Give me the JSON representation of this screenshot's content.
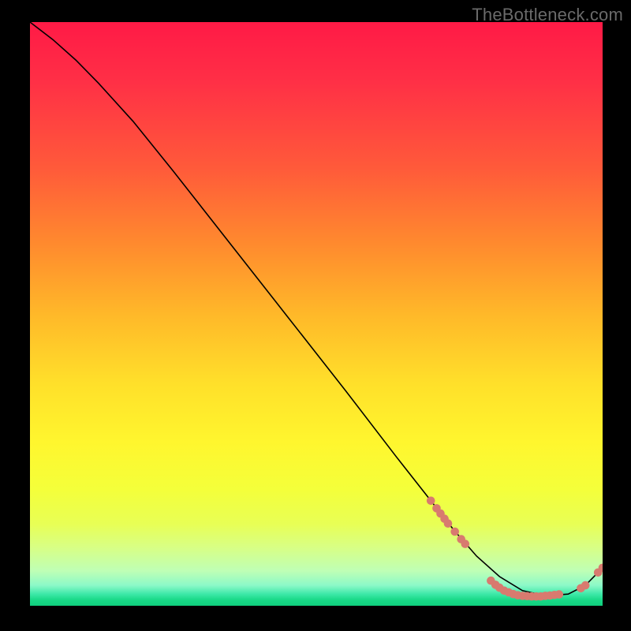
{
  "watermark": "TheBottleneck.com",
  "colors": {
    "line": "#000000",
    "marker": "#d87a6f",
    "background": "#000000"
  },
  "chart_data": {
    "type": "line",
    "title": "",
    "xlabel": "",
    "ylabel": "",
    "xlim": [
      0,
      100
    ],
    "ylim": [
      0,
      100
    ],
    "grid": false,
    "legend": false,
    "series": [
      {
        "name": "curve",
        "x": [
          0,
          4,
          8,
          12,
          18,
          25,
          35,
          45,
          55,
          64,
          70,
          74,
          78,
          82,
          86,
          90,
          94,
          97,
          100
        ],
        "y": [
          100,
          97,
          93.5,
          89.5,
          83,
          74.5,
          62,
          49.5,
          37,
          25.5,
          18,
          13,
          8.5,
          5,
          2.6,
          1.7,
          2.0,
          3.5,
          6.5
        ]
      }
    ],
    "markers": [
      {
        "x": 70.0,
        "y": 18.0
      },
      {
        "x": 71.0,
        "y": 16.7
      },
      {
        "x": 71.7,
        "y": 15.8
      },
      {
        "x": 72.4,
        "y": 14.9
      },
      {
        "x": 73.0,
        "y": 14.1
      },
      {
        "x": 74.2,
        "y": 12.7
      },
      {
        "x": 75.3,
        "y": 11.4
      },
      {
        "x": 76.0,
        "y": 10.6
      },
      {
        "x": 80.5,
        "y": 4.3
      },
      {
        "x": 81.3,
        "y": 3.6
      },
      {
        "x": 82.0,
        "y": 3.1
      },
      {
        "x": 82.8,
        "y": 2.6
      },
      {
        "x": 83.6,
        "y": 2.3
      },
      {
        "x": 84.4,
        "y": 2.0
      },
      {
        "x": 85.2,
        "y": 1.8
      },
      {
        "x": 86.0,
        "y": 1.7
      },
      {
        "x": 86.8,
        "y": 1.65
      },
      {
        "x": 87.6,
        "y": 1.6
      },
      {
        "x": 88.4,
        "y": 1.6
      },
      {
        "x": 89.2,
        "y": 1.6
      },
      {
        "x": 90.0,
        "y": 1.7
      },
      {
        "x": 90.8,
        "y": 1.75
      },
      {
        "x": 91.6,
        "y": 1.85
      },
      {
        "x": 92.4,
        "y": 1.95
      },
      {
        "x": 96.2,
        "y": 3.0
      },
      {
        "x": 97.0,
        "y": 3.5
      },
      {
        "x": 99.2,
        "y": 5.7
      },
      {
        "x": 100.0,
        "y": 6.5
      }
    ]
  }
}
